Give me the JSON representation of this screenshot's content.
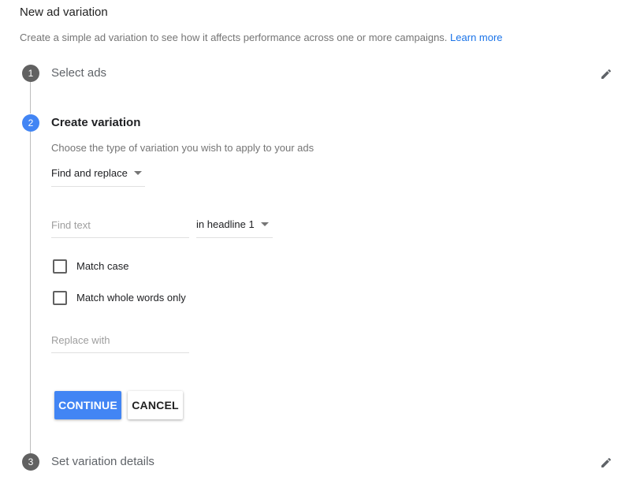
{
  "header": {
    "title": "New ad variation",
    "intro_text": "Create a simple ad variation to see how it affects performance across one or more campaigns.",
    "learn_more": "Learn more"
  },
  "steps": [
    {
      "number": "1",
      "title": "Select ads",
      "state": "done"
    },
    {
      "number": "2",
      "title": "Create variation",
      "state": "active"
    },
    {
      "number": "3",
      "title": "Set variation details",
      "state": "pending"
    }
  ],
  "variation": {
    "hint": "Choose the type of variation you wish to apply to your ads",
    "type_selected": "Find and replace",
    "find_placeholder": "Find text",
    "find_value": "",
    "target_selected": "in headline 1",
    "match_case_label": "Match case",
    "match_case_checked": false,
    "match_whole_label": "Match whole words only",
    "match_whole_checked": false,
    "replace_placeholder": "Replace with",
    "replace_value": ""
  },
  "buttons": {
    "continue": "CONTINUE",
    "cancel": "CANCEL"
  },
  "colors": {
    "accent": "#4285f4",
    "link": "#1a73e8",
    "step_done": "#616161"
  },
  "icons": {
    "edit": "pencil-icon"
  }
}
